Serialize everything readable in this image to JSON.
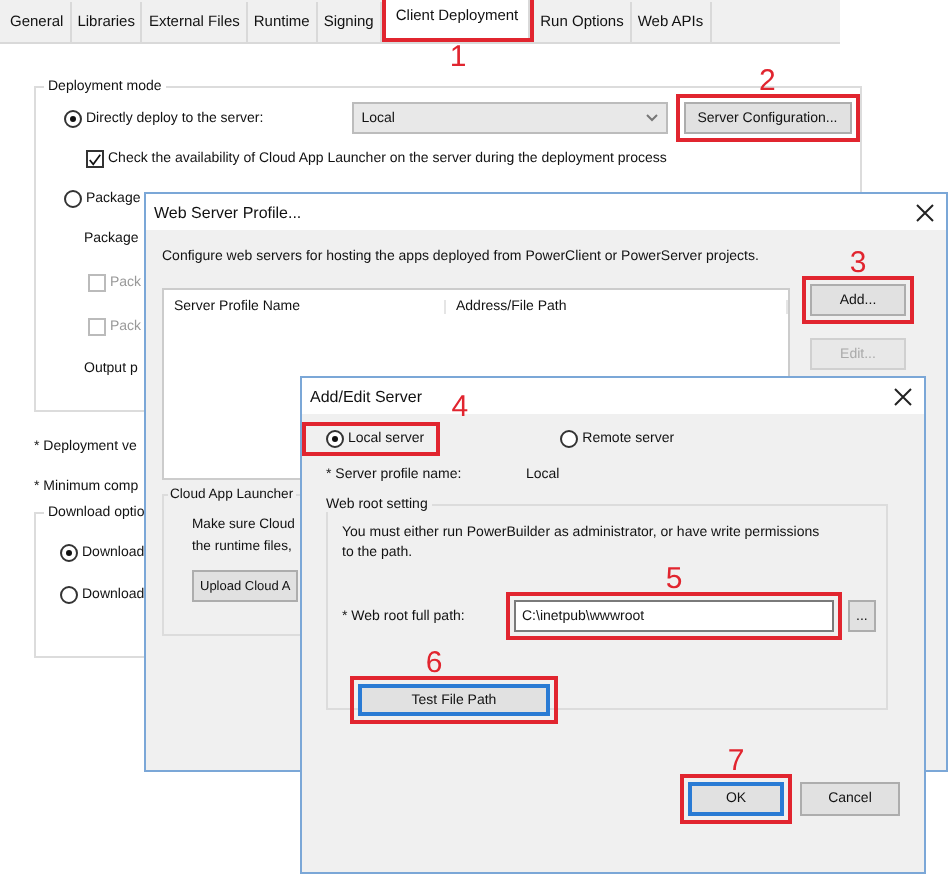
{
  "tabs": [
    {
      "label": "General",
      "selected": false
    },
    {
      "label": "Libraries",
      "selected": false
    },
    {
      "label": "External Files",
      "selected": false
    },
    {
      "label": "Runtime",
      "selected": false
    },
    {
      "label": "Signing",
      "selected": false
    },
    {
      "label": "Client Deployment",
      "selected": true,
      "callout": "1"
    },
    {
      "label": "Run Options",
      "selected": false
    },
    {
      "label": "Web APIs",
      "selected": false
    }
  ],
  "deployment_mode": {
    "title": "Deployment mode",
    "direct": {
      "label": "Directly deploy to the server:",
      "selected": true
    },
    "server_select": {
      "value": "Local"
    },
    "server_configuration_button": {
      "label": "Server Configuration...",
      "callout": "2"
    },
    "check_cloud": {
      "label": "Check the availability of Cloud App Launcher on the server during the deployment process",
      "checked": true
    },
    "package": {
      "label": "Package",
      "selected": false
    },
    "package_label": "Package",
    "package_checks": [
      {
        "label": "Pack",
        "checked": false
      },
      {
        "label": "Pack",
        "checked": false
      }
    ],
    "output_label": "Output p"
  },
  "deployment_version_label": "* Deployment ve",
  "minimum_label": "* Minimum comp",
  "download_options": {
    "title": "Download optio",
    "options": [
      {
        "label": "Download",
        "selected": true
      },
      {
        "label": "Download",
        "selected": false
      }
    ]
  },
  "web_server_profile": {
    "title": "Web Server Profile...",
    "description": "Configure web servers for hosting the apps deployed from PowerClient or PowerServer projects.",
    "columns": [
      "Server Profile Name",
      "Address/File Path"
    ],
    "buttons": [
      {
        "label": "Add...",
        "disabled": false,
        "callout": "3"
      },
      {
        "label": "Edit...",
        "disabled": true
      }
    ],
    "cloud_group": {
      "title": "Cloud App Launcher",
      "lines": [
        "Make sure Cloud",
        "the runtime files,"
      ],
      "upload_button": "Upload Cloud A"
    }
  },
  "add_edit_server": {
    "title": "Add/Edit Server",
    "server_types": [
      {
        "label": "Local server",
        "selected": true,
        "callout": "4"
      },
      {
        "label": "Remote server",
        "selected": false
      }
    ],
    "profile_name_label": "* Server profile name:",
    "profile_name": "Local",
    "web_root": {
      "title": "Web root setting",
      "note": "You must either run PowerBuilder as administrator, or have write permissions to the path.",
      "path_label": "* Web root full path:",
      "path_value": "C:\\inetpub\\wwwroot",
      "path_callout": "5",
      "browse_button": "...",
      "test_button": {
        "label": "Test File Path",
        "callout": "6"
      }
    },
    "ok_button": {
      "label": "OK",
      "callout": "7"
    },
    "cancel_button": {
      "label": "Cancel"
    }
  }
}
